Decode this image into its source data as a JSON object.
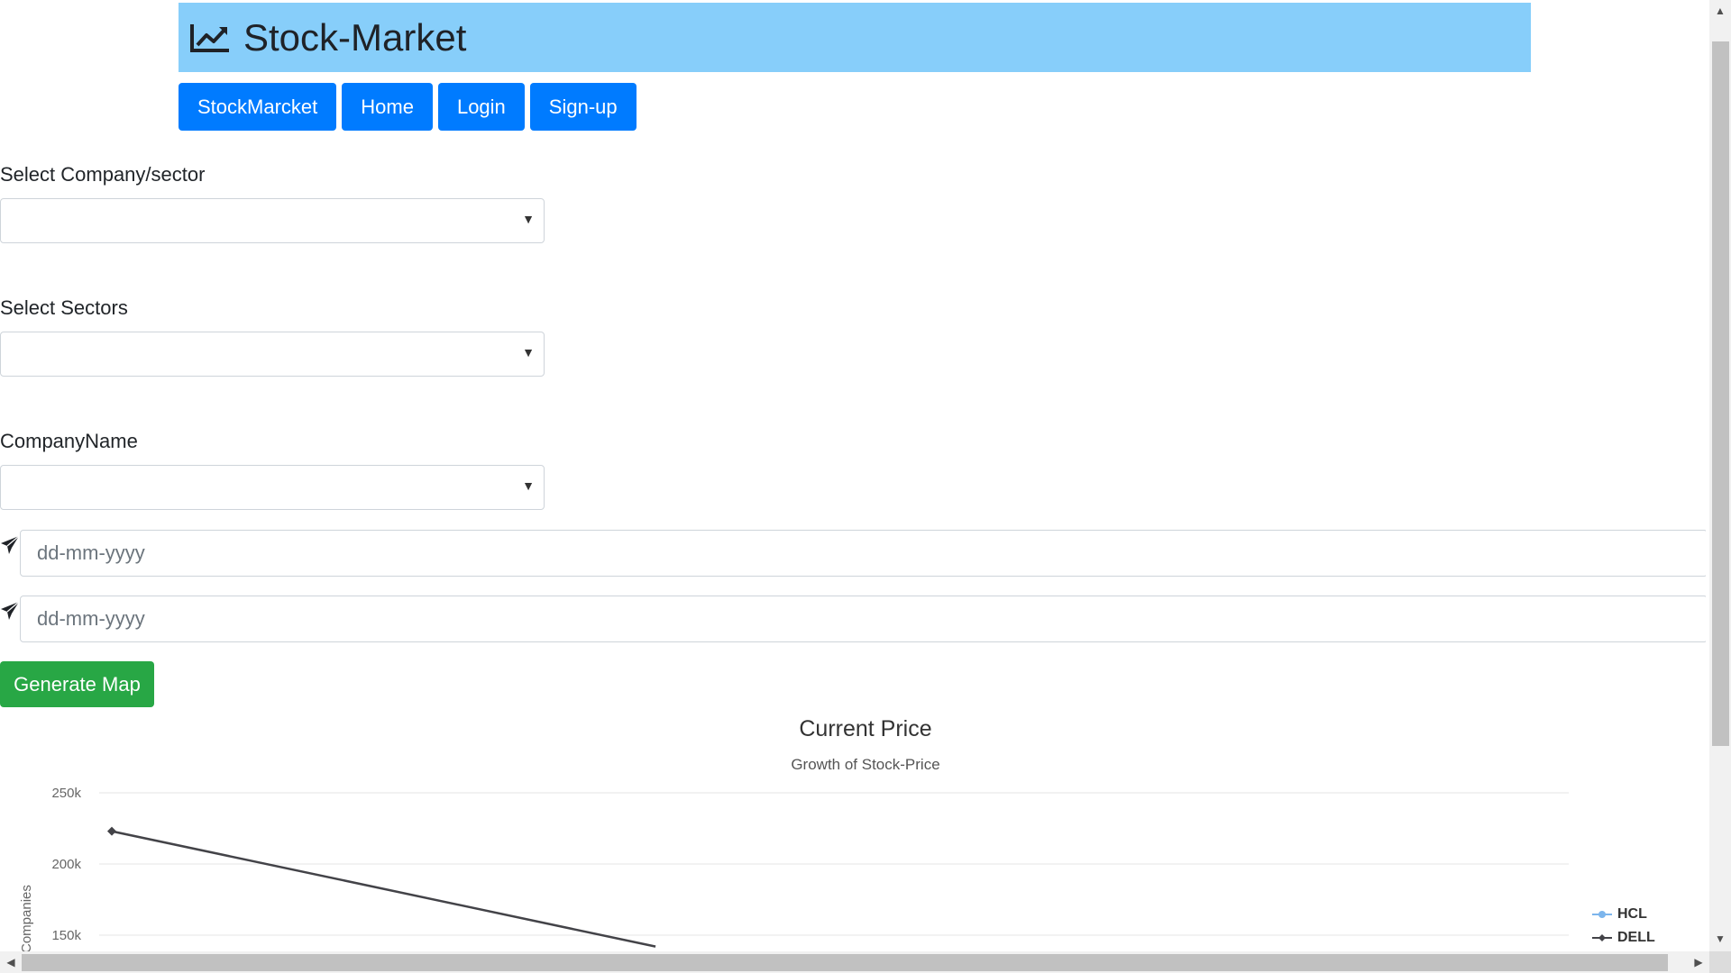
{
  "header": {
    "title": "Stock-Market",
    "logo_icon": "chart-line-icon"
  },
  "nav": [
    {
      "label": "StockMarcket"
    },
    {
      "label": "Home"
    },
    {
      "label": "Login"
    },
    {
      "label": "Sign-up"
    }
  ],
  "form": {
    "company_sector_label": "Select Company/sector",
    "sectors_label": "Select Sectors",
    "company_name_label": "CompanyName",
    "from_date_placeholder": "dd-mm-yyyy",
    "to_date_placeholder": "dd-mm-yyyy",
    "date_icon": "paper-plane-icon",
    "generate_label": "Generate Map"
  },
  "colors": {
    "header_bg": "#87cefa",
    "nav_button": "#007bff",
    "generate_button": "#28a745",
    "series_hcl": "#7cb5ec",
    "series_dell": "#434348"
  },
  "chart_data": {
    "type": "line",
    "title": "Current Price",
    "subtitle": "Growth of Stock-Price",
    "ylabel": "Companies",
    "y_ticks": [
      "250k",
      "200k",
      "150k"
    ],
    "ylim": [
      100000,
      250000
    ],
    "legend_position": "right",
    "series": [
      {
        "name": "HCL",
        "values": []
      },
      {
        "name": "DELL",
        "values": [
          223000,
          142000
        ],
        "x_fraction": [
          0.0,
          0.37
        ]
      }
    ]
  }
}
